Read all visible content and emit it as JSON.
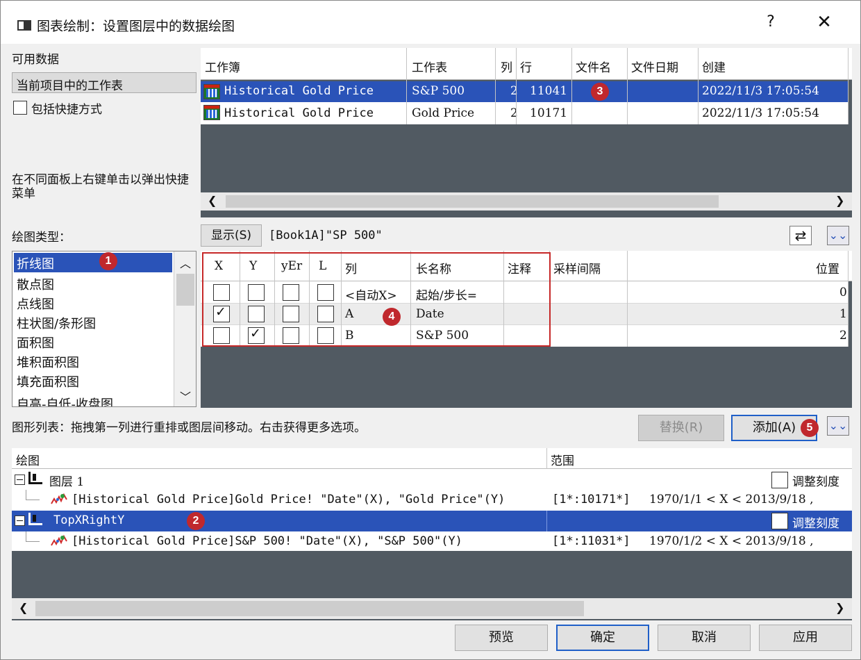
{
  "window": {
    "title": "图表绘制：设置图层中的数据绘图",
    "help": "?",
    "close": "✕"
  },
  "left": {
    "available_data": "可用数据",
    "source_combo": "当前项目中的工作表",
    "include_shortcuts": "包括快捷方式",
    "hint": "在不同面板上右键单击以弹出快捷菜单",
    "plot_type_label": "绘图类型：",
    "plot_types": [
      "折线图",
      "散点图",
      "点线图",
      "柱状图/条形图",
      "面积图",
      "堆积面积图",
      "填充面积图",
      "自高-自低-收盘图"
    ]
  },
  "book_table": {
    "headers": [
      "工作簿",
      "工作表",
      "列",
      "行",
      "文件名",
      "文件日期",
      "创建"
    ],
    "rows": [
      {
        "book": "Historical Gold Price",
        "sheet": "S&P 500",
        "cols": "2",
        "rows": "11041",
        "file": "",
        "date": "",
        "created": "2022/11/3 17:05:54"
      },
      {
        "book": "Historical Gold Price",
        "sheet": "Gold Price",
        "cols": "2",
        "rows": "10171",
        "file": "",
        "date": "",
        "created": "2022/11/3 17:05:54"
      }
    ]
  },
  "show_button": "显示(S)",
  "sheet_ref": "[Book1A]\"SP 500\"",
  "col_table": {
    "headers": [
      "X",
      "Y",
      "yEr",
      "L",
      "列",
      "长名称",
      "注释",
      "采样间隔",
      "位置"
    ],
    "rows": [
      {
        "x": false,
        "y": false,
        "col": "<自动X>",
        "longname": "起始/步长=",
        "pos": "0"
      },
      {
        "x": true,
        "y": false,
        "col": "A",
        "longname": "Date",
        "pos": "1"
      },
      {
        "x": false,
        "y": true,
        "col": "B",
        "longname": "S&P 500",
        "pos": "2"
      }
    ]
  },
  "plot_list_hint": "图形列表：拖拽第一列进行重排或图层间移动。右击获得更多选项。",
  "replace_button": "替换(R)",
  "add_button": "添加(A)",
  "plot_list": {
    "headers": [
      "绘图",
      "范围"
    ],
    "layer1": "图层 1",
    "plot1": "[Historical Gold Price]Gold Price! \"Date\"(X), \"Gold Price\"(Y)",
    "plot1_range": "[1*:10171*]",
    "plot1_range2": "1970/1/1 < X < 2013/9/18 ,",
    "layer2": "TopXRightY",
    "plot2": "[Historical Gold Price]S&P 500! \"Date\"(X), \"S&P 500\"(Y)",
    "plot2_range": "[1*:11031*]",
    "plot2_range2": "1970/1/2 < X < 2013/9/18 ,",
    "rescale": "调整刻度"
  },
  "footer": {
    "preview": "预览",
    "ok": "确定",
    "cancel": "取消",
    "apply": "应用"
  },
  "badges": [
    "1",
    "2",
    "3",
    "4",
    "5"
  ],
  "colors": {
    "selection": "#2a53b8",
    "panel": "#515a62",
    "badge": "#c0282d",
    "highlight": "#c62828"
  }
}
